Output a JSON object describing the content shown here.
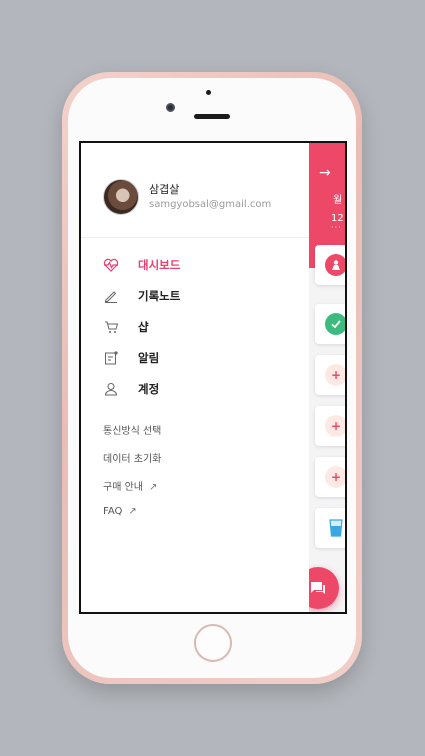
{
  "profile": {
    "name": "삼겹살",
    "email": "samgyobsal@gmail.com"
  },
  "menu": [
    {
      "label": "대시보드",
      "icon": "heartbeat-icon",
      "active": true
    },
    {
      "label": "기록노트",
      "icon": "pencil-icon",
      "active": false
    },
    {
      "label": "샵",
      "icon": "cart-icon",
      "active": false
    },
    {
      "label": "알림",
      "icon": "notice-icon",
      "active": false
    },
    {
      "label": "계정",
      "icon": "user-icon",
      "active": false
    }
  ],
  "sub_menu": [
    {
      "label": "통신방식 선택"
    },
    {
      "label": "데이터 초기화"
    },
    {
      "label": "구매 안내",
      "external": true
    },
    {
      "label": "FAQ",
      "external": true
    }
  ],
  "header": {
    "month_char": "월",
    "day": "12",
    "dots": "···"
  },
  "colors": {
    "accent": "#ee4869",
    "active_text": "#ec3d6f",
    "green": "#3dbb7e",
    "water": "#3aa8e0"
  }
}
